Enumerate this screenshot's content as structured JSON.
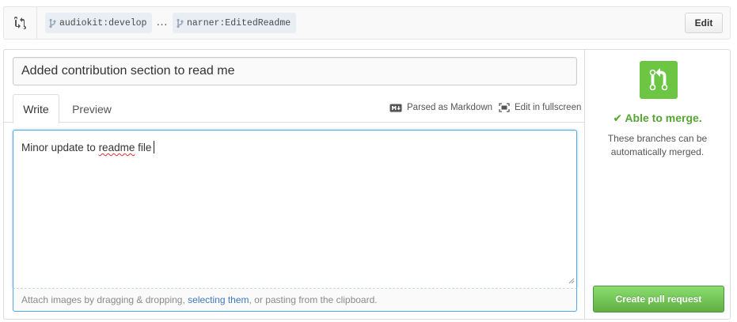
{
  "compare": {
    "base_branch": "audiokit:develop",
    "separator": "…",
    "head_branch": "narner:EditedReadme",
    "edit_label": "Edit"
  },
  "form": {
    "title_value": "Added contribution section to read me",
    "tabs": [
      {
        "label": "Write",
        "active": true
      },
      {
        "label": "Preview",
        "active": false
      }
    ],
    "markdown_label": "Parsed as Markdown",
    "fullscreen_label": "Edit in fullscreen",
    "body_prefix": "Minor update to ",
    "body_misspelled": "readme",
    "body_suffix": " file",
    "attach": {
      "before": "Attach images by dragging & dropping, ",
      "link": "selecting them",
      "after": ", or pasting from the clipboard."
    }
  },
  "merge": {
    "status": "✔ Able to merge.",
    "description": "These branches can be automatically merged.",
    "create_label": "Create pull request"
  },
  "icons": {
    "compare": "git-compare-icon",
    "branch": "git-branch-icon",
    "markdown": "markdown-icon",
    "fullscreen": "fullscreen-icon",
    "pull_request": "git-pull-request-icon"
  },
  "colors": {
    "merge_green": "#6cc644",
    "merge_text": "#55a532",
    "focus_blue": "#51a7e8",
    "link_blue": "#4078c0"
  }
}
